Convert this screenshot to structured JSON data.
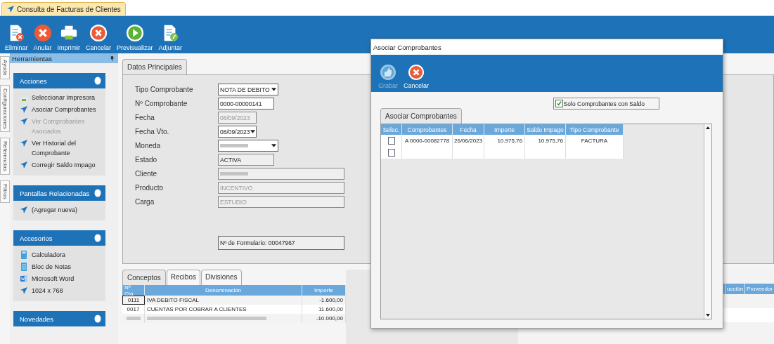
{
  "window": {
    "title": "Consulta de Facturas de Clientes"
  },
  "toolbar": [
    {
      "label": "Eliminar"
    },
    {
      "label": "Anular"
    },
    {
      "label": "Imprimir"
    },
    {
      "label": "Cancelar"
    },
    {
      "label": "Previsualizar"
    },
    {
      "label": "Adjuntar"
    }
  ],
  "side_tabs": [
    "Ayuda",
    "Configuraciones",
    "Referencias",
    "Filtros"
  ],
  "tools_panel": {
    "title": "Herramientas",
    "sections": [
      {
        "title": "Acciones",
        "items": [
          {
            "label": "Seleccionar Impresora",
            "disabled": false
          },
          {
            "label": "Asociar Comprobantes",
            "disabled": false
          },
          {
            "label": "Ver Comprobantes Asociados",
            "disabled": true
          },
          {
            "label": "Ver Historial del Comprobante",
            "disabled": false
          },
          {
            "label": "Corregir Saldo Impago",
            "disabled": false
          }
        ]
      },
      {
        "title": "Pantallas Relacionadas",
        "items": [
          {
            "label": "(Agregar nueva)",
            "disabled": false
          }
        ]
      },
      {
        "title": "Accesorios",
        "items": [
          {
            "label": "Calculadora",
            "disabled": false
          },
          {
            "label": "Bloc de Notas",
            "disabled": false
          },
          {
            "label": "Microsoft Word",
            "disabled": false
          },
          {
            "label": "1024 x 768",
            "disabled": false
          }
        ]
      },
      {
        "title": "Novedades"
      }
    ]
  },
  "main_tab": "Datos Principales",
  "fields": [
    {
      "label": "Tipo Comprobante",
      "value": "NOTA DE DEBITO",
      "kind": "select",
      "disabled": false,
      "readonly": false,
      "blurred": false
    },
    {
      "label": "Nº Comprobante",
      "value": "0000-00000141",
      "kind": "text",
      "disabled": false,
      "readonly": false,
      "blurred": false
    },
    {
      "label": "Fecha",
      "value": "08/09/2023",
      "kind": "date",
      "disabled": true,
      "readonly": false,
      "blurred": false
    },
    {
      "label": "Fecha Vto.",
      "value": "08/09/2023",
      "kind": "date-select",
      "disabled": false,
      "readonly": false,
      "blurred": false
    },
    {
      "label": "Moneda",
      "kind": "select",
      "disabled": false,
      "readonly": false,
      "blurred": true
    },
    {
      "label": "Estado",
      "value": "ACTIVA",
      "kind": "text",
      "disabled": false,
      "readonly": true,
      "blurred": false
    },
    {
      "label": "Cliente",
      "kind": "wide",
      "disabled": true,
      "readonly": false,
      "blurred": true
    },
    {
      "label": "Producto",
      "value": "INCENTIVO",
      "kind": "wide",
      "disabled": true,
      "readonly": false,
      "blurred": false
    },
    {
      "label": "Carga",
      "value": "ESTUDIO",
      "kind": "wide",
      "disabled": true,
      "readonly": false,
      "blurred": false
    }
  ],
  "form_number": "Nº de Formulario: 00047967",
  "lower_tabs": [
    {
      "label": "Conceptos",
      "selected": true
    },
    {
      "label": "Recibos",
      "selected": false
    },
    {
      "label": "Divisiones",
      "selected": false
    }
  ],
  "concepts_table": {
    "columns": [
      "Nº Cta.",
      "Denominación",
      "Importe"
    ],
    "rows": [
      {
        "cta": "0111",
        "denominacion": "IVA DEBITO FISCAL",
        "importe": "-1.600,00",
        "focused": true,
        "blurred": false
      },
      {
        "cta": "0017",
        "denominacion": "CUENTAS POR COBRAR A CLIENTES",
        "importe": "11.600,00",
        "focused": false,
        "blurred": false
      },
      {
        "importe": "-10.000,00",
        "focused": false,
        "blurred": true
      }
    ]
  },
  "background_grid": {
    "columns": [
      "ucción",
      "Proveedor"
    ]
  },
  "dialog": {
    "title": "Asociar Comprobantes",
    "buttons": [
      {
        "label": "Grabar",
        "kind": "save",
        "disabled": true
      },
      {
        "label": "Cancelar",
        "kind": "cancel",
        "disabled": false
      }
    ],
    "filter": {
      "label": "Solo Comprobantes con Saldo",
      "checked": true
    },
    "tab": "Asociar Comprobantes",
    "columns": [
      "Selec.",
      "Comprobantes",
      "Fecha",
      "Importe",
      "Saldo Impago",
      "Tipo Comprobante"
    ],
    "rows": [
      {
        "checked": false,
        "comprobante": "A 0000-00082778",
        "fecha": "26/06/2023",
        "importe": "10.975,76",
        "saldo": "10.975,76",
        "tipo": "FACTURA"
      },
      {
        "checked": false
      }
    ]
  }
}
